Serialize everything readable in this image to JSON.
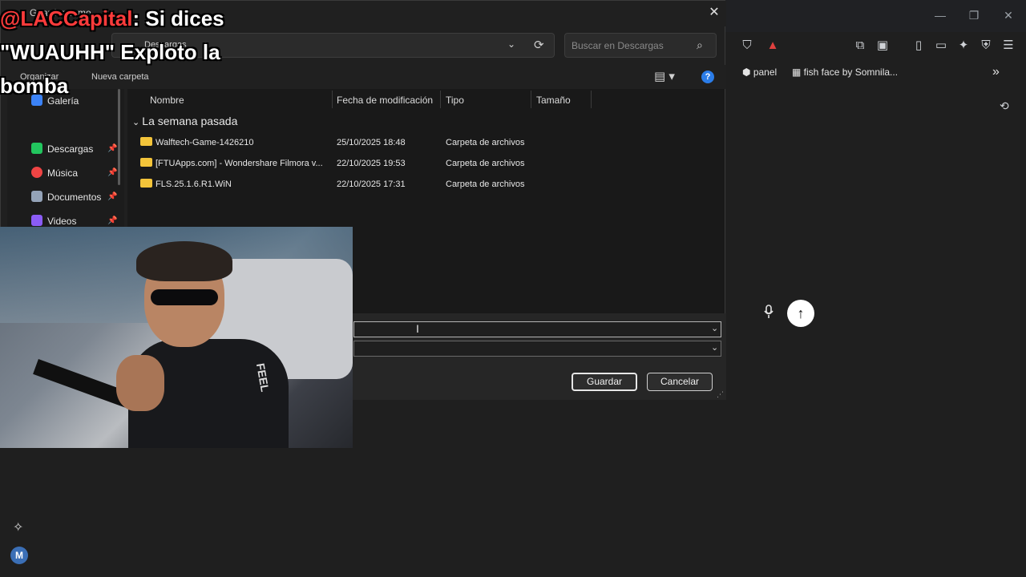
{
  "browser": {
    "bookmarks": [
      "panel",
      "fish face by Somnila..."
    ],
    "more_bookmarks": "»"
  },
  "dialog": {
    "title": "Guardar como",
    "address": "Descargas",
    "search_placeholder": "Buscar en Descargas",
    "organize": "Organizar",
    "new_folder": "Nueva carpeta",
    "nav": [
      {
        "label": "Galería",
        "color": "#3b82f6"
      },
      {
        "label": "Descargas",
        "color": "#22c55e"
      },
      {
        "label": "Música",
        "color": "#ef4444"
      },
      {
        "label": "Documentos",
        "color": "#94a3b8"
      },
      {
        "label": "Videos",
        "color": "#8b5cf6"
      }
    ],
    "columns": [
      "Nombre",
      "Fecha de modificación",
      "Tipo",
      "Tamaño"
    ],
    "group": "La semana pasada",
    "files": [
      {
        "name": "Walftech-Game-1426210",
        "date": "25/10/2025 18:48",
        "type": "Carpeta de archivos"
      },
      {
        "name": "[FTUApps.com] - Wondershare Filmora v...",
        "date": "22/10/2025 19:53",
        "type": "Carpeta de archivos"
      },
      {
        "name": "FLS.25.1.6.R1.WiN",
        "date": "22/10/2025 17:31",
        "type": "Carpeta de archivos"
      }
    ],
    "save_label": "Guardar",
    "cancel_label": "Cancelar"
  },
  "caption": {
    "user": "@LACCapital",
    "text": ": Si dices \"WUAUHH\" Exploto la bomba"
  },
  "webcam": {
    "shirt_text": "FEEL"
  },
  "sidebar_avatar": "M",
  "icons": {
    "close": "✕",
    "refresh": "⟳",
    "search": "⌕",
    "help": "?",
    "mic": "🎤",
    "send": "↑",
    "sparkle": "✧"
  }
}
